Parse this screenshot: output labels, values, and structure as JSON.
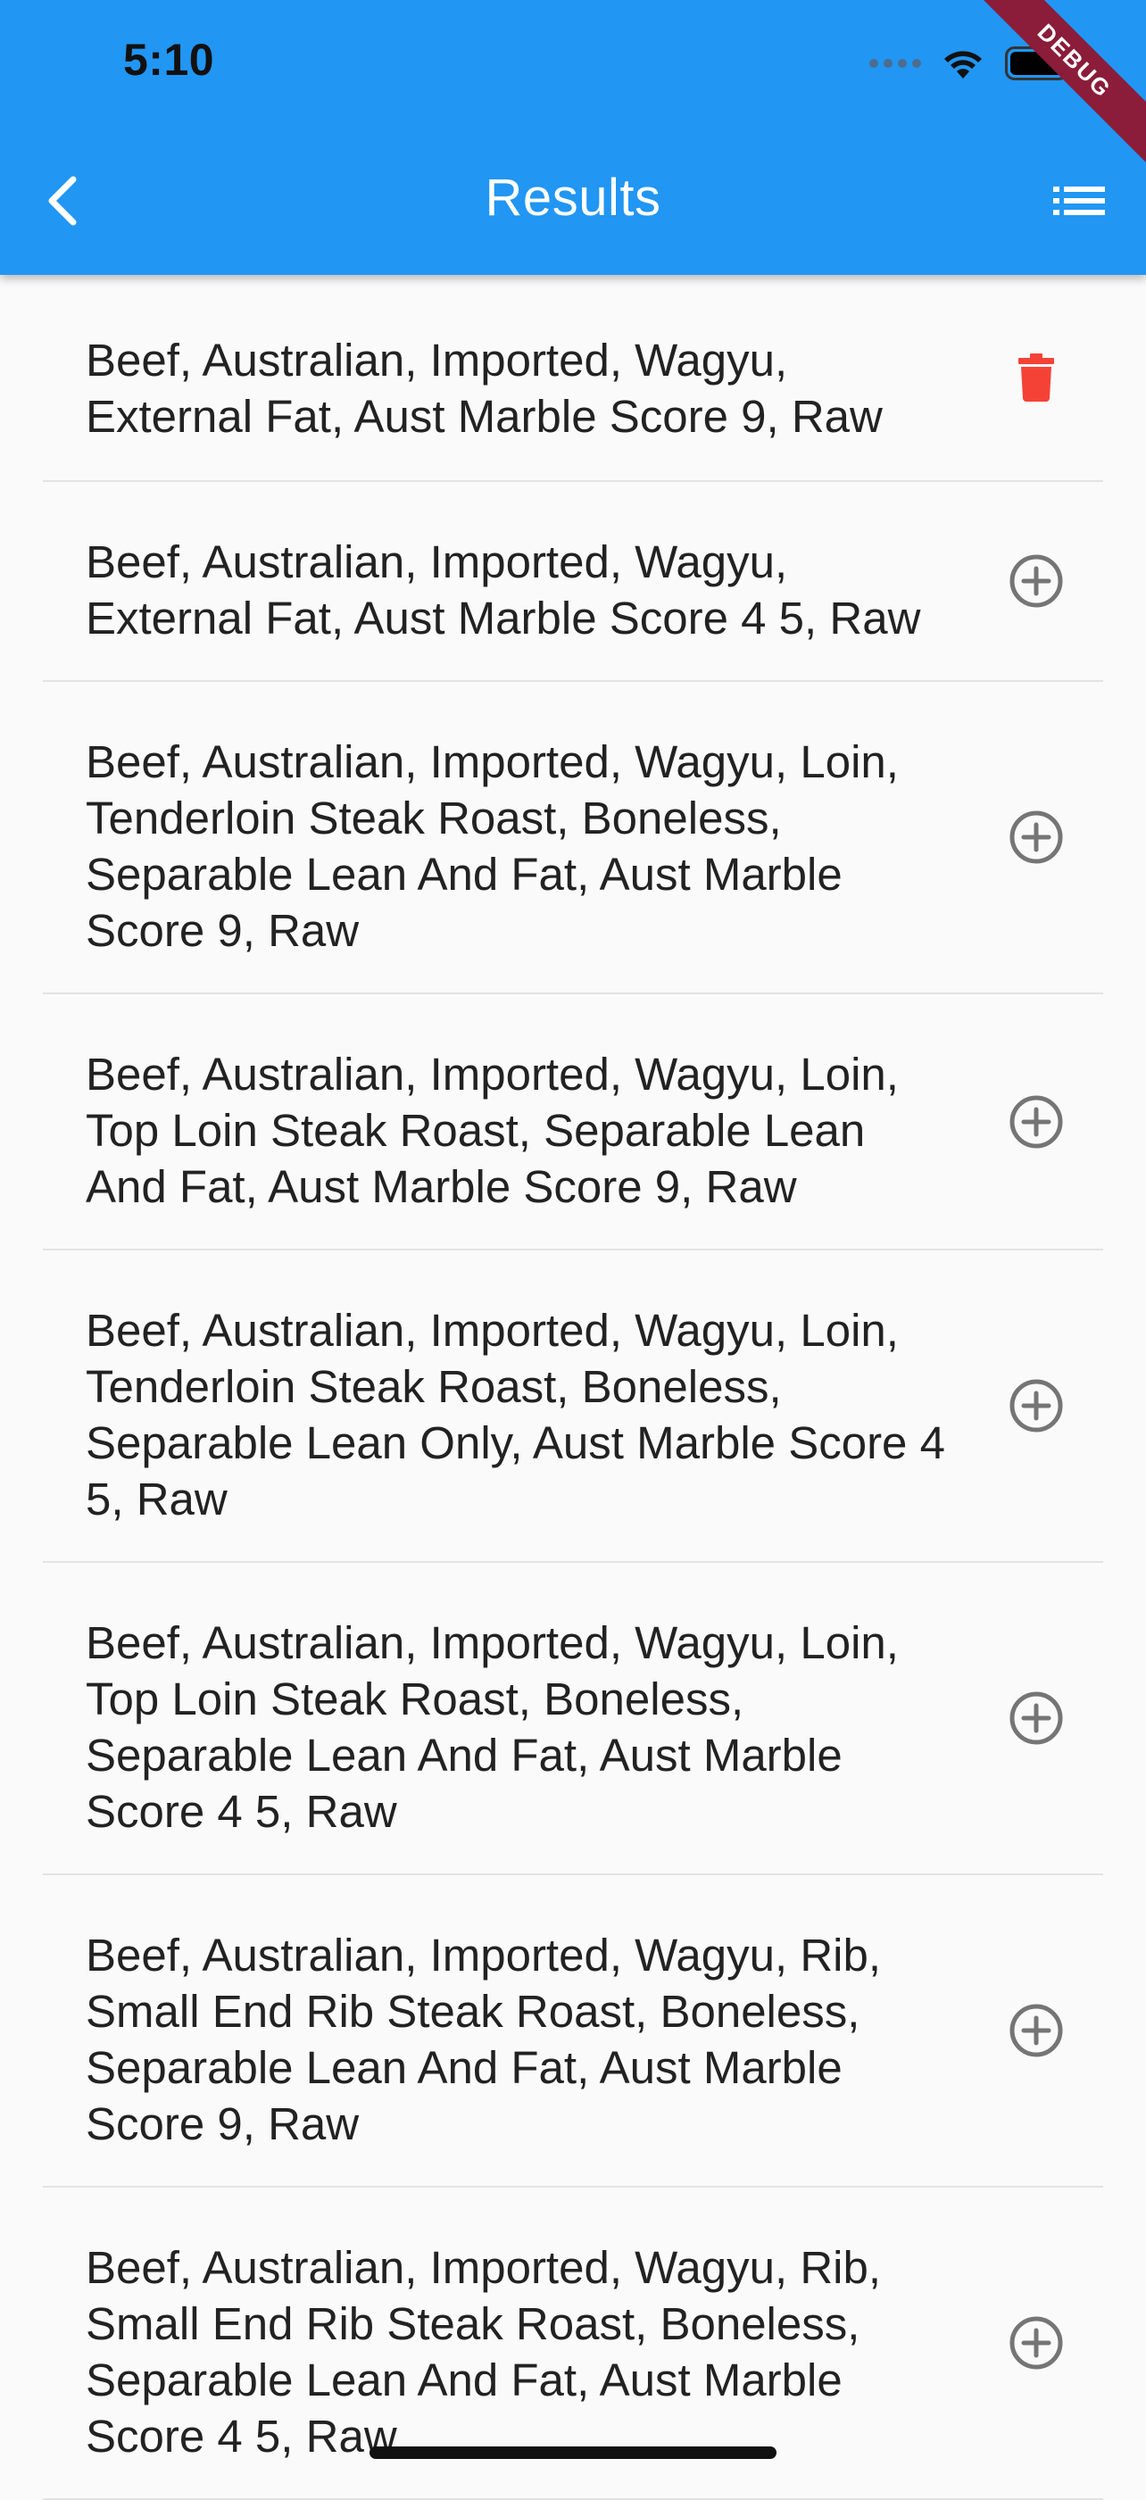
{
  "status_bar": {
    "time": "5:10"
  },
  "app_bar": {
    "title": "Results",
    "debug_label": "DEBUG",
    "background_color": "#2196f3",
    "back_icon": "chevron-left-icon",
    "menu_icon": "list-icon"
  },
  "results": [
    {
      "label": "Beef, Australian, Imported, Wagyu, External Fat, Aust Marble Score 9, Raw",
      "action": "delete",
      "action_icon": "trash-icon",
      "action_color": "#f44336"
    },
    {
      "label": "Beef, Australian, Imported, Wagyu, External Fat, Aust Marble Score 4 5, Raw",
      "action": "add",
      "action_icon": "add-circle-icon",
      "action_color": "#757575"
    },
    {
      "label": "Beef, Australian, Imported, Wagyu, Loin, Tenderloin Steak Roast, Boneless, Separable Lean And Fat, Aust Marble Score 9, Raw",
      "action": "add",
      "action_icon": "add-circle-icon",
      "action_color": "#757575"
    },
    {
      "label": "Beef, Australian, Imported, Wagyu, Loin, Top Loin Steak Roast, Separable Lean And Fat, Aust Marble Score 9, Raw",
      "action": "add",
      "action_icon": "add-circle-icon",
      "action_color": "#757575"
    },
    {
      "label": "Beef, Australian, Imported, Wagyu, Loin, Tenderloin Steak Roast, Boneless, Separable Lean Only, Aust Marble Score 4 5, Raw",
      "action": "add",
      "action_icon": "add-circle-icon",
      "action_color": "#757575"
    },
    {
      "label": "Beef, Australian, Imported, Wagyu, Loin, Top Loin Steak Roast, Boneless, Separable Lean And Fat, Aust Marble Score 4 5, Raw",
      "action": "add",
      "action_icon": "add-circle-icon",
      "action_color": "#757575"
    },
    {
      "label": "Beef, Australian, Imported, Wagyu, Rib, Small End Rib Steak Roast, Boneless, Separable Lean And Fat, Aust Marble Score 9, Raw",
      "action": "add",
      "action_icon": "add-circle-icon",
      "action_color": "#757575"
    },
    {
      "label": "Beef, Australian, Imported, Wagyu, Rib, Small End Rib Steak Roast, Boneless, Separable Lean And Fat, Aust Marble Score 4 5, Raw",
      "action": "add",
      "action_icon": "add-circle-icon",
      "action_color": "#757575"
    }
  ]
}
